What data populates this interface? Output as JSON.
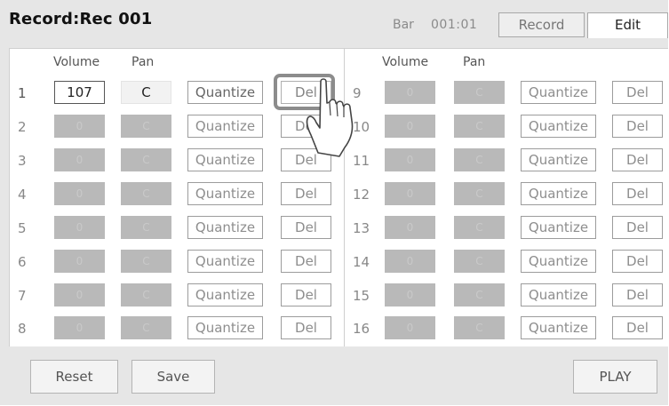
{
  "title": "Record:Rec 001",
  "bar": {
    "label": "Bar",
    "value": "001:01"
  },
  "tabs": {
    "record": "Record",
    "edit": "Edit"
  },
  "columns": {
    "volume": "Volume",
    "pan": "Pan"
  },
  "buttons": {
    "quantize": "Quantize",
    "del": "Del",
    "reset": "Reset",
    "save": "Save",
    "play": "PLAY"
  },
  "tracks": [
    {
      "num": "1",
      "volume": "107",
      "pan": "C",
      "active": true
    },
    {
      "num": "2",
      "volume": "0",
      "pan": "C",
      "active": false
    },
    {
      "num": "3",
      "volume": "0",
      "pan": "C",
      "active": false
    },
    {
      "num": "4",
      "volume": "0",
      "pan": "C",
      "active": false
    },
    {
      "num": "5",
      "volume": "0",
      "pan": "C",
      "active": false
    },
    {
      "num": "6",
      "volume": "0",
      "pan": "C",
      "active": false
    },
    {
      "num": "7",
      "volume": "0",
      "pan": "C",
      "active": false
    },
    {
      "num": "8",
      "volume": "0",
      "pan": "C",
      "active": false
    },
    {
      "num": "9",
      "volume": "0",
      "pan": "C",
      "active": false
    },
    {
      "num": "10",
      "volume": "0",
      "pan": "C",
      "active": false
    },
    {
      "num": "11",
      "volume": "0",
      "pan": "C",
      "active": false
    },
    {
      "num": "12",
      "volume": "0",
      "pan": "C",
      "active": false
    },
    {
      "num": "13",
      "volume": "0",
      "pan": "C",
      "active": false
    },
    {
      "num": "14",
      "volume": "0",
      "pan": "C",
      "active": false
    },
    {
      "num": "15",
      "volume": "0",
      "pan": "C",
      "active": false
    },
    {
      "num": "16",
      "volume": "0",
      "pan": "C",
      "active": false
    }
  ],
  "pointer_icon": "pointing-hand-icon",
  "colors": {
    "background": "#e6e6e6",
    "panel": "#ffffff",
    "disabled_field": "#b9b9b9",
    "highlight_ring": "#8c8c8c"
  }
}
